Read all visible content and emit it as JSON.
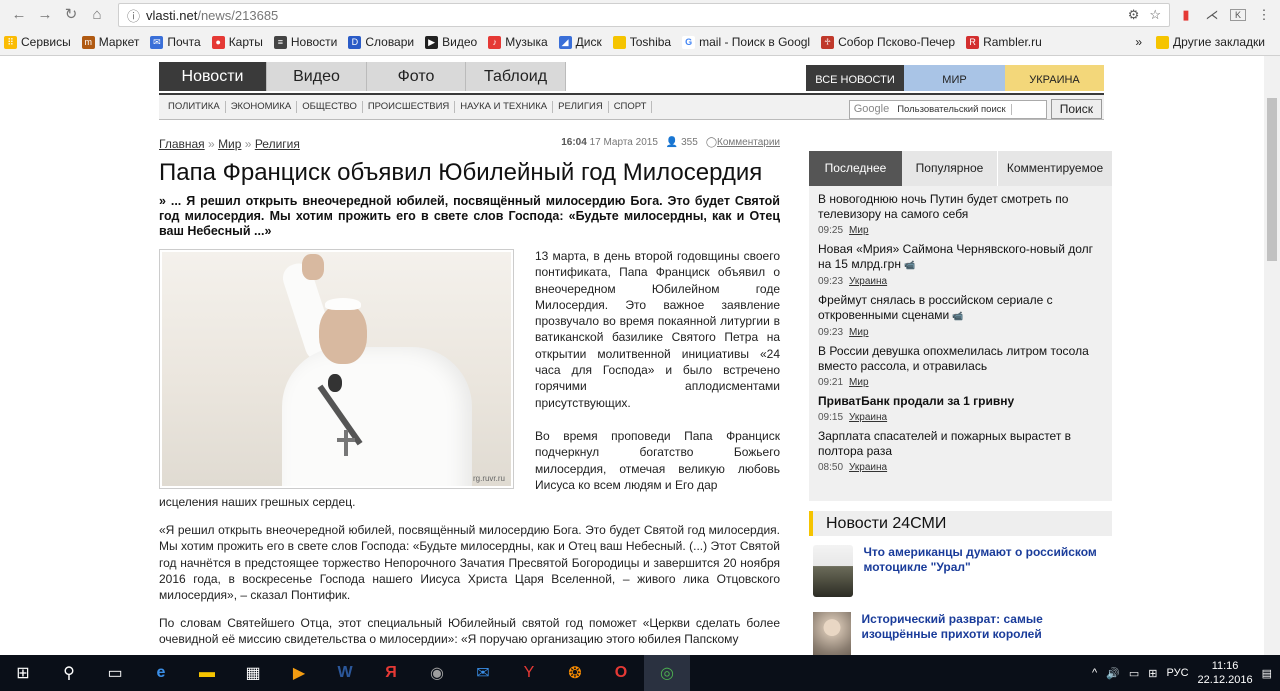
{
  "browser": {
    "url_host": "vlasti.net",
    "url_path": "/news/213685",
    "bookmarks": [
      "Сервисы",
      "Маркет",
      "Почта",
      "Карты",
      "Новости",
      "Словари",
      "Видео",
      "Музыка",
      "Диск",
      "Toshiba",
      "mail - Поиск в Googl",
      "Собор Псково-Печер",
      "Rambler.ru"
    ],
    "more": "»",
    "other_bookmarks": "Другие закладки"
  },
  "site": {
    "main_tabs": [
      "Новости",
      "Видео",
      "Фото",
      "Таблоид"
    ],
    "right_tabs": [
      "ВСЕ НОВОСТИ",
      "МИР",
      "УКРАИНА"
    ],
    "sub_nav": [
      "ПОЛИТИКА",
      "ЭКОНОМИКА",
      "ОБЩЕСТВО",
      "ПРОИСШЕСТВИЯ",
      "НАУКА И ТЕХНИКА",
      "РЕЛИГИЯ",
      "СПОРТ"
    ],
    "search_logo": "Google",
    "search_placeholder": "Пользовательский поиск",
    "search_button": "Поиск"
  },
  "article": {
    "breadcrumbs": [
      "Главная",
      "Мир",
      "Религия"
    ],
    "breadcrumb_sep": "»",
    "time": "16:04",
    "date": "17 Марта 2015",
    "views": "355",
    "comments": "Комментарии",
    "title": "Папа Франциск объявил Юбилейный год Милосердия",
    "lead": "» ... Я решил открыть внеочередной юбилей, посвящённый милосердию Бога. Это будет Святой год милосердия. Мы хотим прожить его в свете слов Господа: «Будьте милосердны, как и Отец ваш Небесный ...»",
    "photo_watermark": "rg.ruvr.ru",
    "p1": "13 марта, в день второй годовщины своего понтификата, Папа Франциск объявил о внеочередном Юбилейном годе Милосердия. Это важное заявление прозвучало во время покаянной литургии в ватиканской базилике Святого Петра на открытии молитвенной инициативы «24 часа для Господа» и было встречено горячими аплодисментами присутствующих.",
    "p2a": "Во время проповеди Папа Франциск подчеркнул богатство Божьего милосердия, отмечая великую любовь Иисуса ко всем людям и Его дар",
    "p2b": "исцеления наших грешных сердец.",
    "p3": "«Я решил открыть внеочередной юбилей, посвящённый милосердию Бога. Это будет Святой год милосердия. Мы хотим прожить его в свете слов Господа: «Будьте милосердны, как и Отец ваш Небесный. (...) Этот Святой год начнётся в предстоящее торжество Непорочного Зачатия Пресвятой Богородицы и завершится 20 ноября 2016 года, в воскресенье Господа нашего Иисуса Христа Царя Вселенной, – живого лика Отцовского милосердия», – сказал Понтифик.",
    "p4": "По словам Святейшего Отца, этот специальный Юбилейный святой год поможет «Церкви сделать более очевидной её миссию свидетельства о милосердии»: «Я поручаю организацию этого юбилея Папскому"
  },
  "sidebar": {
    "tabs": [
      "Последнее",
      "Популярное",
      "Комментируемое"
    ],
    "items": [
      {
        "title": "В новогоднюю ночь Путин будет смотреть по телевизору на самого себя",
        "time": "09:25",
        "tag": "Мир"
      },
      {
        "title": "Новая «Мрия» Саймона Чернявского-новый долг на 15 млрд.грн",
        "time": "09:23",
        "tag": "Украина"
      },
      {
        "title": "Фреймут снялась в российском сериале с откровенными сценами",
        "time": "09:23",
        "tag": "Мир"
      },
      {
        "title": "В России девушка опохмелилась литром тосола вместо рассола, и отравилась",
        "time": "09:21",
        "tag": "Мир"
      },
      {
        "title": "ПриватБанк продали за 1 гривну",
        "time": "09:15",
        "tag": "Украина"
      },
      {
        "title": "Зарплата спасателей и пожарных вырастет в полтора раза",
        "time": "08:50",
        "tag": "Украина"
      }
    ],
    "news24_title": "Новости 24СМИ",
    "news24": [
      "Что американцы думают о российском мотоцикле \"Урал\"",
      "Исторический разврат: самые изощрённые прихоти королей"
    ]
  },
  "taskbar": {
    "lang": "РУС",
    "time": "11:16",
    "date": "22.12.2016"
  }
}
